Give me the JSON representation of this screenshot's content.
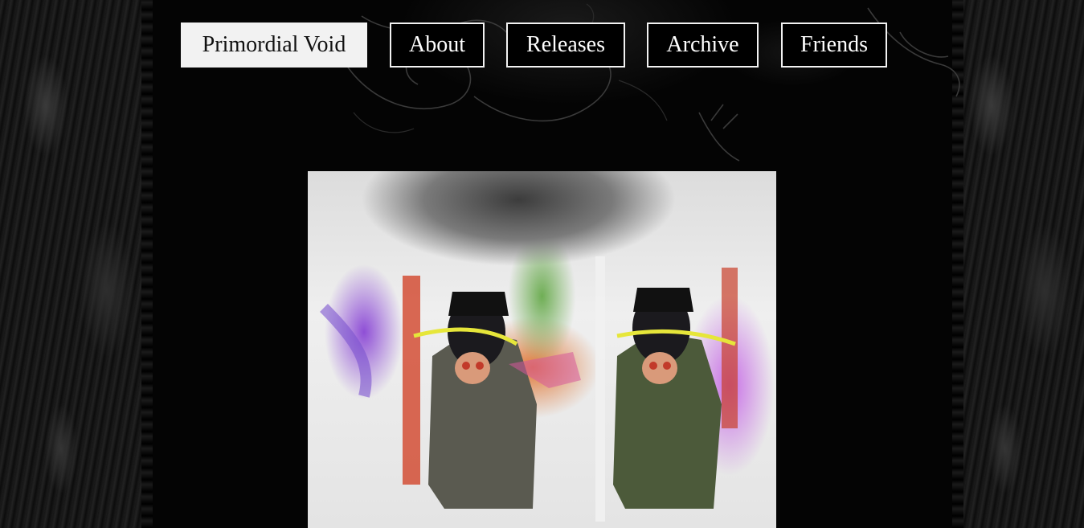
{
  "nav": {
    "items": [
      {
        "label": "Primordial Void",
        "active": true
      },
      {
        "label": "About",
        "active": false
      },
      {
        "label": "Releases",
        "active": false
      },
      {
        "label": "Archive",
        "active": false
      },
      {
        "label": "Friends",
        "active": false
      }
    ]
  },
  "hero": {
    "image_name": "glitch-artwork-image"
  },
  "colors": {
    "background": "#000000",
    "button_border": "#f2f2f2",
    "active_button_bg": "#f2f2f2",
    "active_button_text": "#111111",
    "button_text": "#ffffff"
  }
}
